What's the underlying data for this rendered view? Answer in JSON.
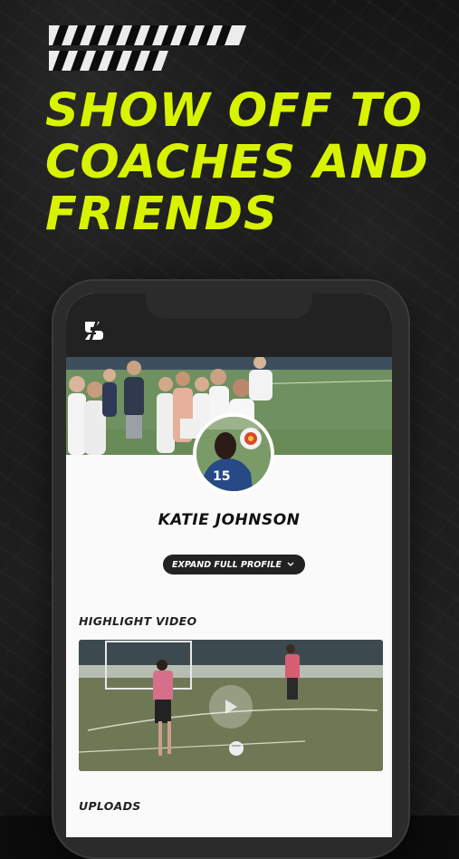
{
  "headline": "SHOW OFF TO COACHES AND FRIENDS",
  "profile": {
    "name": "KATIE JOHNSON",
    "expand_label": "EXPAND FULL PROFILE",
    "jersey_number": "15"
  },
  "sections": {
    "highlight_title": "HIGHLIGHT VIDEO",
    "uploads_title": "UPLOADS"
  },
  "icons": {
    "logo": "app-logo-icon",
    "chevron": "chevron-down-icon",
    "play": "play-icon"
  },
  "colors": {
    "accent": "#d8f300",
    "background": "#101010",
    "phone_frame": "#2b2b2b",
    "app_bar": "#222222"
  }
}
